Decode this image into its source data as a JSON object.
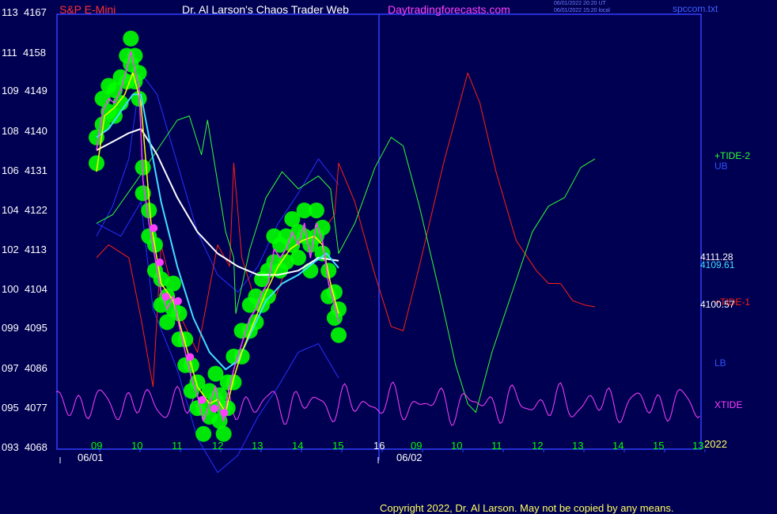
{
  "header": {
    "symbol": "S&P E-Mini",
    "title": "Dr. Al Larson's Chaos Trader Web",
    "site": "Daytradingforecasts.com",
    "stamp_utc": "06/01/2022 20:20 UT",
    "stamp_local": "06/01/2022 15:20 local",
    "file": "spccom.txt"
  },
  "colors": {
    "background": "#000052",
    "frame": "#3040ff",
    "price": "#ff40ff",
    "bands": "#00ff00",
    "ma_fast": "#ffff00",
    "ma_mid": "#40e0ff",
    "ma_slow": "#ffffff",
    "envelope": "#2830ff",
    "tide1": "#ff2010",
    "tide2": "#30ff30",
    "xtide": "#ff40ff"
  },
  "chart_data": {
    "type": "line",
    "title": "S&P E-Mini",
    "y_axis_labels": [
      {
        "left": "113",
        "right": "4167"
      },
      {
        "left": "111",
        "right": "4158"
      },
      {
        "left": "109",
        "right": "4149"
      },
      {
        "left": "108",
        "right": "4140"
      },
      {
        "left": "106",
        "right": "4131"
      },
      {
        "left": "104",
        "right": "4122"
      },
      {
        "left": "102",
        "right": "4113"
      },
      {
        "left": "100",
        "right": "4104"
      },
      {
        "left": "099",
        "right": "4095"
      },
      {
        "left": "097",
        "right": "4086"
      },
      {
        "left": "095",
        "right": "4077"
      },
      {
        "left": "093",
        "right": "4068"
      }
    ],
    "ylim": [
      4068,
      4167
    ],
    "x_hours": [
      "09",
      "10",
      "11",
      "12",
      "13",
      "14",
      "15",
      "16",
      "09",
      "10",
      "11",
      "12",
      "13",
      "14",
      "15",
      "13"
    ],
    "x_dates": [
      "06/01",
      "06/02"
    ],
    "year": "2022",
    "now_hour_index": 7,
    "price_series": {
      "name": "S&P E-Mini",
      "points": [
        [
          0,
          4137
        ],
        [
          0.15,
          4146
        ],
        [
          0.3,
          4149
        ],
        [
          0.45,
          4148
        ],
        [
          0.6,
          4151
        ],
        [
          0.75,
          4156
        ],
        [
          0.85,
          4160
        ],
        [
          0.95,
          4156
        ],
        [
          1.05,
          4152
        ],
        [
          1.15,
          4130
        ],
        [
          1.3,
          4120
        ],
        [
          1.45,
          4112
        ],
        [
          1.6,
          4104
        ],
        [
          1.75,
          4100
        ],
        [
          1.9,
          4103
        ],
        [
          2.05,
          4096
        ],
        [
          2.2,
          4090
        ],
        [
          2.35,
          4084
        ],
        [
          2.5,
          4080
        ],
        [
          2.65,
          4074
        ],
        [
          2.8,
          4078
        ],
        [
          2.95,
          4082
        ],
        [
          3.05,
          4077
        ],
        [
          3.15,
          4074
        ],
        [
          3.25,
          4080
        ],
        [
          3.4,
          4086
        ],
        [
          3.6,
          4092
        ],
        [
          3.8,
          4098
        ],
        [
          3.95,
          4100
        ],
        [
          4.1,
          4104
        ],
        [
          4.25,
          4106
        ],
        [
          4.4,
          4114
        ],
        [
          4.55,
          4112
        ],
        [
          4.7,
          4114
        ],
        [
          4.85,
          4118
        ],
        [
          5.0,
          4115
        ],
        [
          5.15,
          4120
        ],
        [
          5.3,
          4112
        ],
        [
          5.45,
          4120
        ],
        [
          5.6,
          4116
        ],
        [
          5.75,
          4106
        ],
        [
          5.9,
          4101
        ],
        [
          6.0,
          4097
        ]
      ]
    },
    "ma_fast": {
      "name": "fast average",
      "points": [
        [
          0,
          4132
        ],
        [
          0.2,
          4145
        ],
        [
          0.45,
          4147
        ],
        [
          0.7,
          4150
        ],
        [
          0.9,
          4155
        ],
        [
          1.1,
          4148
        ],
        [
          1.35,
          4120
        ],
        [
          1.6,
          4106
        ],
        [
          1.9,
          4102
        ],
        [
          2.2,
          4092
        ],
        [
          2.5,
          4082
        ],
        [
          2.8,
          4078
        ],
        [
          3.0,
          4079
        ],
        [
          3.2,
          4076
        ],
        [
          3.4,
          4084
        ],
        [
          3.6,
          4090
        ],
        [
          3.9,
          4097
        ],
        [
          4.2,
          4104
        ],
        [
          4.5,
          4110
        ],
        [
          4.8,
          4114
        ],
        [
          5.1,
          4116
        ],
        [
          5.4,
          4117
        ],
        [
          5.6,
          4115
        ],
        [
          5.8,
          4106
        ],
        [
          6.0,
          4099
        ]
      ]
    },
    "ma_mid": {
      "name": "medium average",
      "points": [
        [
          0,
          4140
        ],
        [
          0.3,
          4142
        ],
        [
          0.6,
          4146
        ],
        [
          0.9,
          4150
        ],
        [
          1.1,
          4150
        ],
        [
          1.3,
          4140
        ],
        [
          1.6,
          4125
        ],
        [
          2.0,
          4110
        ],
        [
          2.4,
          4098
        ],
        [
          2.8,
          4090
        ],
        [
          3.2,
          4086
        ],
        [
          3.5,
          4088
        ],
        [
          3.8,
          4094
        ],
        [
          4.2,
          4102
        ],
        [
          4.6,
          4106
        ],
        [
          5.0,
          4108
        ],
        [
          5.4,
          4111
        ],
        [
          5.7,
          4113
        ],
        [
          6.0,
          4109.61
        ]
      ]
    },
    "ma_slow": {
      "name": "slow average",
      "points": [
        [
          0,
          4137
        ],
        [
          0.4,
          4139
        ],
        [
          0.8,
          4141
        ],
        [
          1.1,
          4142
        ],
        [
          1.5,
          4136
        ],
        [
          2.0,
          4126
        ],
        [
          2.5,
          4118
        ],
        [
          3.0,
          4113
        ],
        [
          3.5,
          4110
        ],
        [
          4.0,
          4108
        ],
        [
          4.5,
          4108
        ],
        [
          5.0,
          4109
        ],
        [
          5.5,
          4112
        ],
        [
          6.0,
          4111.28
        ]
      ]
    },
    "upper_env": {
      "name": "UB",
      "points": [
        [
          0,
          4117
        ],
        [
          0.4,
          4124
        ],
        [
          0.8,
          4135
        ],
        [
          1.1,
          4155
        ],
        [
          1.5,
          4150
        ],
        [
          2.0,
          4134
        ],
        [
          2.5,
          4118
        ],
        [
          3.0,
          4108
        ],
        [
          3.5,
          4104
        ],
        [
          4.0,
          4110
        ],
        [
          4.5,
          4120
        ],
        [
          5.0,
          4127
        ],
        [
          5.5,
          4135
        ],
        [
          6.0,
          4129
        ]
      ]
    },
    "lower_env": {
      "name": "LB",
      "points": [
        [
          0,
          4120
        ],
        [
          0.6,
          4117
        ],
        [
          1.1,
          4125
        ],
        [
          1.4,
          4100
        ],
        [
          2.0,
          4086
        ],
        [
          2.5,
          4070
        ],
        [
          3.0,
          4062
        ],
        [
          3.5,
          4066
        ],
        [
          4.0,
          4075
        ],
        [
          4.5,
          4082
        ],
        [
          5.0,
          4090
        ],
        [
          5.5,
          4092
        ],
        [
          6.0,
          4084
        ]
      ]
    },
    "tide1": {
      "name": "+TIDE-1",
      "label": "+TIDE-1",
      "points": [
        [
          0,
          4112
        ],
        [
          0.3,
          4115
        ],
        [
          0.8,
          4112
        ],
        [
          1.1,
          4098
        ],
        [
          1.4,
          4082
        ],
        [
          1.6,
          4115
        ],
        [
          2.0,
          4100
        ],
        [
          2.5,
          4090
        ],
        [
          3.0,
          4115
        ],
        [
          3.3,
          4110
        ],
        [
          3.4,
          4134
        ],
        [
          3.6,
          4112
        ],
        [
          4.0,
          4100
        ],
        [
          4.4,
          4102
        ],
        [
          4.8,
          4112
        ],
        [
          5.2,
          4118
        ],
        [
          5.6,
          4118
        ],
        [
          5.9,
          4122
        ],
        [
          6.0,
          4134
        ],
        [
          6.4,
          4125
        ],
        [
          6.9,
          4108
        ],
        [
          7.3,
          4096
        ],
        [
          7.6,
          4095
        ],
        [
          8.0,
          4110
        ],
        [
          8.6,
          4134
        ],
        [
          9.0,
          4148
        ],
        [
          9.2,
          4155
        ],
        [
          9.5,
          4148
        ],
        [
          9.9,
          4132
        ],
        [
          10.4,
          4116
        ],
        [
          10.9,
          4109
        ],
        [
          11.2,
          4106
        ],
        [
          11.5,
          4106
        ],
        [
          11.8,
          4102
        ],
        [
          12.1,
          4101
        ],
        [
          12.35,
          4100.57
        ]
      ]
    },
    "tide2": {
      "name": "+TIDE-2",
      "label": "+TIDE-2",
      "points": [
        [
          0,
          4120
        ],
        [
          0.4,
          4122
        ],
        [
          1.0,
          4130
        ],
        [
          1.5,
          4137
        ],
        [
          2.0,
          4144
        ],
        [
          2.3,
          4145
        ],
        [
          2.6,
          4136
        ],
        [
          2.75,
          4144
        ],
        [
          3.2,
          4118
        ],
        [
          3.4,
          4112
        ],
        [
          3.45,
          4099
        ],
        [
          3.8,
          4114
        ],
        [
          4.2,
          4126
        ],
        [
          4.6,
          4132
        ],
        [
          5.0,
          4128
        ],
        [
          5.5,
          4131
        ],
        [
          5.8,
          4128
        ],
        [
          6.0,
          4113
        ],
        [
          6.4,
          4120
        ],
        [
          6.9,
          4133
        ],
        [
          7.3,
          4140
        ],
        [
          7.6,
          4138
        ],
        [
          8.0,
          4124
        ],
        [
          8.5,
          4104
        ],
        [
          8.9,
          4087
        ],
        [
          9.2,
          4078
        ],
        [
          9.4,
          4076
        ],
        [
          9.8,
          4090
        ],
        [
          10.3,
          4104
        ],
        [
          10.8,
          4118
        ],
        [
          11.2,
          4124
        ],
        [
          11.6,
          4126
        ],
        [
          12.0,
          4133
        ],
        [
          12.35,
          4135
        ]
      ]
    },
    "xtide_label": "XTIDE",
    "ub_label": "UB",
    "lb_label": "LB",
    "readouts": {
      "slow": "4111.28",
      "mid": "4109.61",
      "tide1": "4100.57"
    }
  },
  "copyright": "Copyright 2022, Dr. Al Larson. May not be copied by any means."
}
